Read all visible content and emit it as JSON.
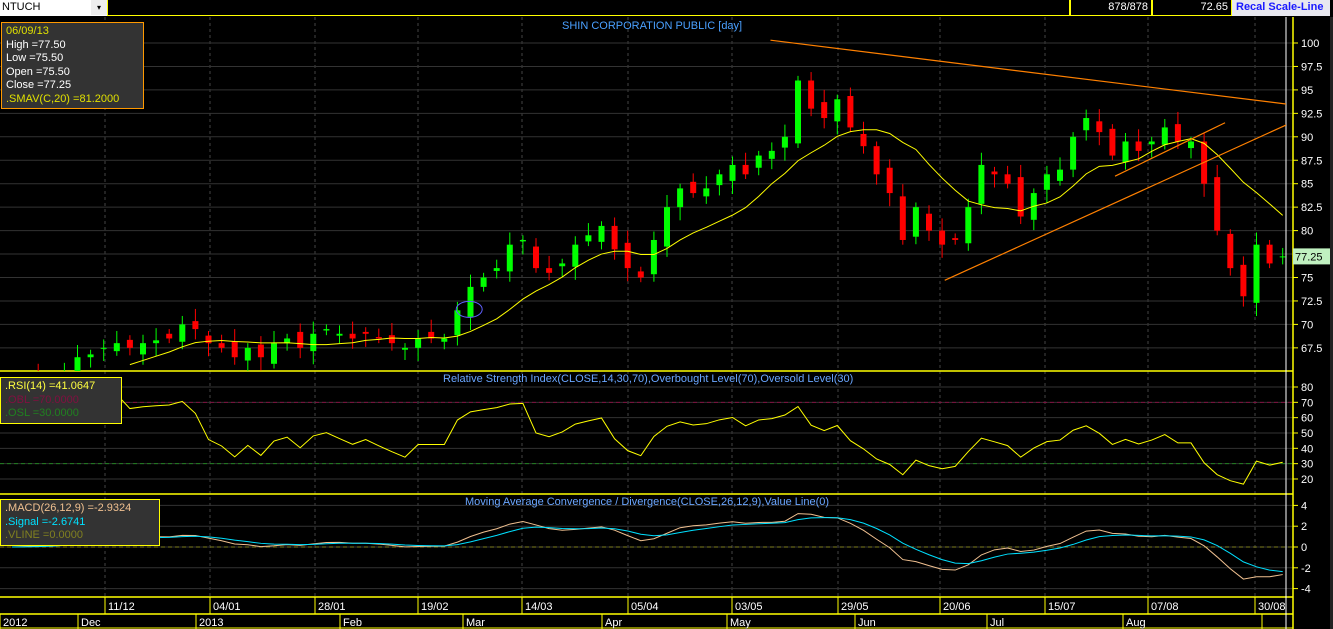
{
  "toolbar": {
    "symbol": "NTUCH",
    "dropdown_icon": "▾",
    "count": "878/878",
    "price": "72.65",
    "recal_button": "Recal Scale-Line"
  },
  "info_box": {
    "date": "06/09/13",
    "high": "High  =77.50",
    "low": "Low  =75.50",
    "open": "Open  =75.50",
    "close": "Close  =77.25",
    "smav": ".SMAV(C,20)   =81.2000"
  },
  "rsi_box": {
    "rsi": ".RSI(14)   =41.0647",
    "obl": ".OBL    =70.0000",
    "osl": ".OSL    =30.0000"
  },
  "macd_box": {
    "macd": ".MACD(26,12,9)   =-2.9324",
    "signal": ".Signal   =-2.6741",
    "vline": ".VLINE   =0.0000"
  },
  "colors": {
    "up": "#00ff00",
    "down": "#ff0000",
    "sma": "#ffff00",
    "trend": "#ff8000",
    "macd": "#f0c090",
    "signal": "#00e0ff",
    "axis": "#ffff00"
  },
  "chart_data": [
    {
      "type": "candlestick",
      "title": "SHIN CORPORATION PUBLIC [day]",
      "ylim": [
        65,
        102
      ],
      "yticks": [
        "100",
        "97.5",
        "95",
        "92.5",
        "90",
        "87.5",
        "85",
        "82.5",
        "80",
        "77.5",
        "75",
        "72.5",
        "70",
        "67.5"
      ],
      "last_price_label": "77.25",
      "close": [
        63.5,
        63.8,
        64,
        64.5,
        65,
        66.5,
        66.8,
        67.5,
        68,
        67.5,
        68,
        68.3,
        68.5,
        70,
        69.5,
        68,
        67.5,
        66.5,
        67.5,
        66.5,
        68,
        68.5,
        67.5,
        69,
        69.5,
        69,
        68.5,
        69,
        68.5,
        68,
        67.5,
        68.5,
        68.5,
        68.5,
        71.5,
        74,
        75,
        76,
        78.5,
        79,
        76,
        75.5,
        76.5,
        78.5,
        79.5,
        80.5,
        78,
        76,
        75,
        79,
        82.5,
        84.5,
        84,
        84.5,
        86,
        87,
        86,
        88,
        88.5,
        90,
        96,
        93,
        92,
        94,
        91,
        89,
        86,
        84,
        79,
        82.5,
        80,
        78.5,
        79,
        82.5,
        87,
        86,
        85,
        81.5,
        84,
        86,
        86.5,
        90,
        92,
        90.5,
        88,
        89.5,
        88.5,
        89.5,
        91,
        89.5,
        89.5,
        85,
        80,
        76,
        73,
        78.5,
        76.5,
        77.25
      ],
      "trendlines": [
        [
          57.9,
          100.3,
          97.8,
          93.4
        ],
        [
          71.2,
          74.7,
          97.8,
          91.6
        ],
        [
          84.2,
          85.8,
          92.6,
          91.5
        ]
      ],
      "ellipse_annotation": [
        34.9,
        71.6
      ]
    },
    {
      "type": "line",
      "title": "Relative Strength Index(CLOSE,14,30,70),Overbought Level(70),Oversold Level(30)",
      "ylim": [
        13,
        86
      ],
      "yticks": [
        "80",
        "70",
        "60",
        "50",
        "40",
        "30",
        "20"
      ],
      "levels": [
        70,
        30
      ]
    },
    {
      "type": "line",
      "title": "Moving Average Convergence / Divergence(CLOSE,26,12,9),Value Line(0)",
      "ylim": [
        -5,
        5
      ],
      "yticks": [
        "4",
        "2",
        "0",
        "-2",
        "-4"
      ],
      "value_line": 0
    }
  ],
  "xaxis": {
    "dates": [
      "11/12",
      "04/01",
      "28/01",
      "19/02",
      "14/03",
      "05/04",
      "03/05",
      "29/05",
      "20/06",
      "15/07",
      "07/08",
      "30/08"
    ],
    "months": [
      "2012",
      "Dec",
      "2013",
      "Feb",
      "Mar",
      "Apr",
      "May",
      "Jun",
      "Jul",
      "Aug"
    ]
  }
}
